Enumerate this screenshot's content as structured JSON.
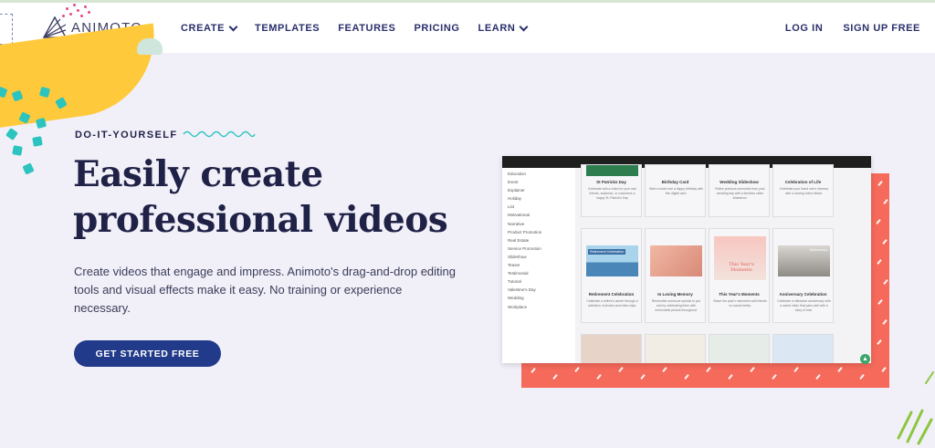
{
  "brand": {
    "name": "ANIMOTO"
  },
  "nav": {
    "items": [
      {
        "label": "CREATE",
        "dropdown": true
      },
      {
        "label": "TEMPLATES",
        "dropdown": false
      },
      {
        "label": "FEATURES",
        "dropdown": false
      },
      {
        "label": "PRICING",
        "dropdown": false
      },
      {
        "label": "LEARN",
        "dropdown": true
      }
    ],
    "login": "LOG IN",
    "signup": "SIGN UP FREE"
  },
  "hero": {
    "eyebrow": "DO-IT-YOURSELF",
    "headline_line1": "Easily create",
    "headline_line2": "professional videos",
    "description": "Create videos that engage and impress. Animoto's drag-and-drop editing tools and visual effects make it easy. No training or experience necessary.",
    "cta": "GET STARTED FREE"
  },
  "mockup": {
    "sidebar": [
      "Education",
      "Event",
      "Explainer",
      "Holiday",
      "List",
      "Motivational",
      "Narrative",
      "Product Promotion",
      "Real Estate",
      "Service Promotion",
      "Slideshow",
      "Teaser",
      "Testimonial",
      "Tutorial",
      "Valentine's Day",
      "Wedding",
      "Workplace"
    ],
    "row1": [
      {
        "title": "St Patricks Day",
        "desc": "Celebrate with a video for your own friends, audience, or coworkers a happy St. Patrick's Day"
      },
      {
        "title": "Birthday Card",
        "desc": "Wish a loved one a happy birthday with this digital card."
      },
      {
        "title": "Wedding Slideshow",
        "desc": "Relive precious memories from your wedding day with a timeless video slideshow."
      },
      {
        "title": "Celebration of Life",
        "desc": "Celebrate your loved one's memory with a moving video tribute."
      }
    ],
    "row2": [
      {
        "title": "Retirement Celebration",
        "desc": "Celebrate a retiree's career through a collection of photos and video clips.",
        "thumb_text": "Retirement Celebration"
      },
      {
        "title": "In Loving Memory",
        "desc": "Remember someone special to you and by celebrating them with memorable photos throughout."
      },
      {
        "title": "This Year's Moments",
        "desc": "Share the year's memories with friends on social media.",
        "thumb_text": "This Year's Moments"
      },
      {
        "title": "Anniversary Celebration",
        "desc": "Celebrate a milestone anniversary with a sweet video that pairs well with a story of love.",
        "thumb_text": "Anniversary"
      }
    ]
  },
  "colors": {
    "accent": "#223a8a",
    "yellow": "#ffc93c",
    "coral": "#f56a5b",
    "teal": "#2bc4be",
    "navy": "#1f2147"
  }
}
